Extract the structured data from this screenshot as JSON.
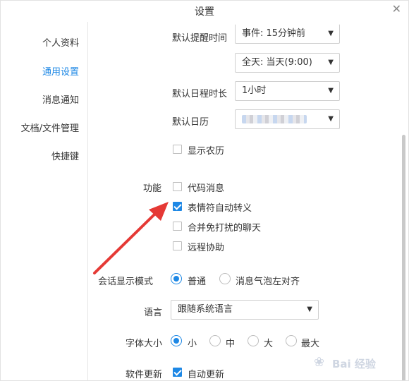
{
  "window": {
    "title": "设置"
  },
  "sidebar": {
    "items": [
      {
        "label": "个人资料",
        "active": false
      },
      {
        "label": "通用设置",
        "active": true
      },
      {
        "label": "消息通知",
        "active": false
      },
      {
        "label": "文档/文件管理",
        "active": false
      },
      {
        "label": "快捷键",
        "active": false
      }
    ]
  },
  "calendar": {
    "reminder_label": "默认提醒时间",
    "reminder_event": "事件: 15分钟前",
    "reminder_allday": "全天: 当天(9:00)",
    "duration_label": "默认日程时长",
    "duration_value": "1小时",
    "default_cal_label": "默认日历",
    "lunar_label": "显示农历",
    "lunar_checked": false
  },
  "features": {
    "label": "功能",
    "options": [
      {
        "label": "代码消息",
        "checked": false
      },
      {
        "label": "表情符自动转义",
        "checked": true
      },
      {
        "label": "合并免打扰的聊天",
        "checked": false
      },
      {
        "label": "远程协助",
        "checked": false
      }
    ]
  },
  "display_mode": {
    "label": "会话显示模式",
    "options": [
      {
        "label": "普通",
        "checked": true
      },
      {
        "label": "消息气泡左对齐",
        "checked": false
      }
    ]
  },
  "language": {
    "label": "语言",
    "value": "跟随系统语言"
  },
  "font_size": {
    "label": "字体大小",
    "options": [
      {
        "label": "小",
        "checked": true
      },
      {
        "label": "中",
        "checked": false
      },
      {
        "label": "大",
        "checked": false
      },
      {
        "label": "最大",
        "checked": false
      }
    ]
  },
  "update": {
    "label": "软件更新",
    "option": "自动更新",
    "checked": true
  },
  "watermark": {
    "text": "Bai 经验"
  },
  "colors": {
    "accent": "#1e88e5",
    "arrow": "#e53935"
  },
  "icons": {
    "close": "close-icon",
    "caret": "chevron-down-icon"
  }
}
